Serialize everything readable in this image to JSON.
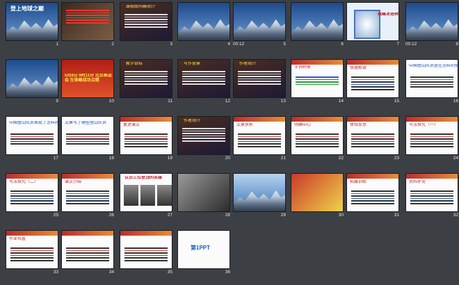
{
  "window": {
    "title": "登上地球之巅"
  },
  "slides": [
    {
      "n": "1",
      "title": "登上地球之巅",
      "kind": "title"
    },
    {
      "n": "2",
      "kind": "redtext"
    },
    {
      "n": "3",
      "kind": "textbg",
      "title": "珠穆朗玛峰简介"
    },
    {
      "n": "4",
      "kind": "photo"
    },
    {
      "n": "5",
      "kind": "photo",
      "time": "00:12"
    },
    {
      "n": "6",
      "kind": "photo"
    },
    {
      "n": "7",
      "kind": "blueframe",
      "caption": "珠峰冰塔林"
    },
    {
      "n": "8",
      "kind": "photo",
      "time": "00:12"
    },
    {
      "n": "9",
      "kind": "photo"
    },
    {
      "n": "10",
      "kind": "poster",
      "caption": "5月8日 9时11分 北京奥运会 在珠峰成功点燃"
    },
    {
      "n": "11",
      "kind": "textbg",
      "title": "教学目标"
    },
    {
      "n": "12",
      "kind": "textbg",
      "title": "写作背景"
    },
    {
      "n": "13",
      "kind": "textbg",
      "title": "作者简介"
    },
    {
      "n": "14",
      "kind": "vocab",
      "title": "字词积累"
    },
    {
      "n": "15",
      "kind": "white",
      "title": "快速默读"
    },
    {
      "n": "16",
      "kind": "blue",
      "title": "中国登山队员是在怎样的情况下登上珠峰的"
    },
    {
      "n": "17",
      "kind": "blue",
      "title": "中国登山队员表现了怎样的精神"
    },
    {
      "n": "18",
      "kind": "blue",
      "title": "文章写了哪些登山队员"
    },
    {
      "n": "19",
      "kind": "white",
      "title": "复述课文"
    },
    {
      "n": "20",
      "kind": "textbg",
      "title": "作者简介"
    },
    {
      "n": "21",
      "kind": "white",
      "title": "文章赏析"
    },
    {
      "n": "22",
      "kind": "white",
      "title": "明确中心"
    },
    {
      "n": "23",
      "kind": "white",
      "title": "体验反思"
    },
    {
      "n": "24",
      "kind": "white",
      "title": "写法探究（一）"
    },
    {
      "n": "25",
      "kind": "white",
      "title": "写法探究（二）"
    },
    {
      "n": "26",
      "kind": "white",
      "title": "课文小结"
    },
    {
      "n": "27",
      "kind": "people",
      "title": "认识三位登顶的英雄"
    },
    {
      "n": "28",
      "kind": "bw"
    },
    {
      "n": "29",
      "kind": "bluegrad"
    },
    {
      "n": "30",
      "kind": "photo2"
    },
    {
      "n": "31",
      "kind": "white",
      "title": "拓展训练"
    },
    {
      "n": "32",
      "kind": "white",
      "title": "资料补充"
    },
    {
      "n": "33",
      "kind": "white",
      "title": "作业布置"
    },
    {
      "n": "34",
      "kind": "white"
    },
    {
      "n": "35",
      "kind": "white"
    },
    {
      "n": "36",
      "kind": "logo",
      "caption": "第1PPT"
    }
  ]
}
